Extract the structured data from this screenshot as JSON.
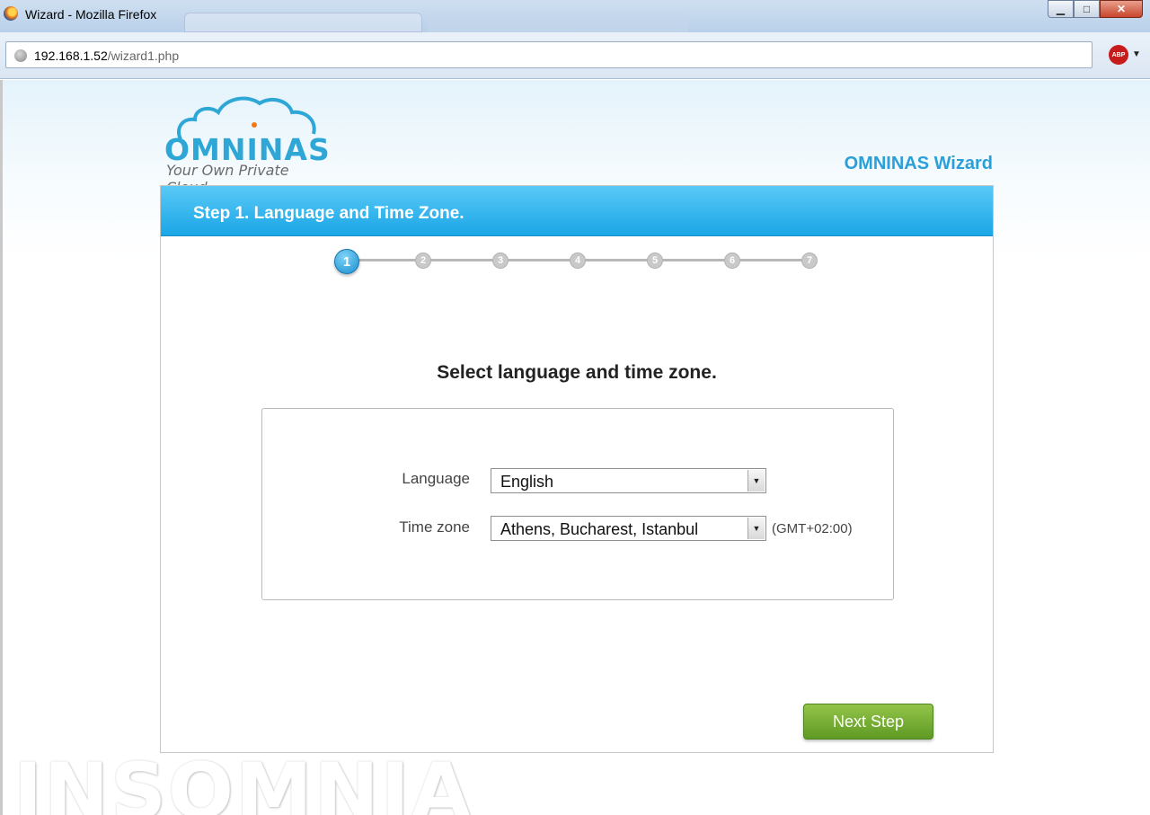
{
  "window": {
    "title": "Wizard - Mozilla Firefox",
    "minimize": "▁",
    "maximize": "□",
    "close": "✕"
  },
  "navbar": {
    "url_host": "192.168.1.52",
    "url_path": "/wizard1.php",
    "adblock_label": "ABP",
    "adblock_dropdown": "▼"
  },
  "logo": {
    "name": "OMNINAS",
    "tagline": "Your Own Private Cloud"
  },
  "wizard_title": "OMNINAS Wizard",
  "panel": {
    "header": "Step 1. Language and Time Zone.",
    "steps": [
      "1",
      "2",
      "3",
      "4",
      "5",
      "6",
      "7"
    ],
    "active_step": 1,
    "heading": "Select language and time zone."
  },
  "form": {
    "language_label": "Language",
    "language_value": "English",
    "timezone_label": "Time zone",
    "timezone_value": "Athens, Bucharest, Istanbul",
    "timezone_offset": "(GMT+02:00)",
    "dropdown_arrow": "▼"
  },
  "next_button": "Next Step",
  "watermark": "INSOMNIA",
  "colors": {
    "accent": "#2b9fd8",
    "header_blue": "#1aa6e6",
    "button_green": "#6fa62f"
  }
}
